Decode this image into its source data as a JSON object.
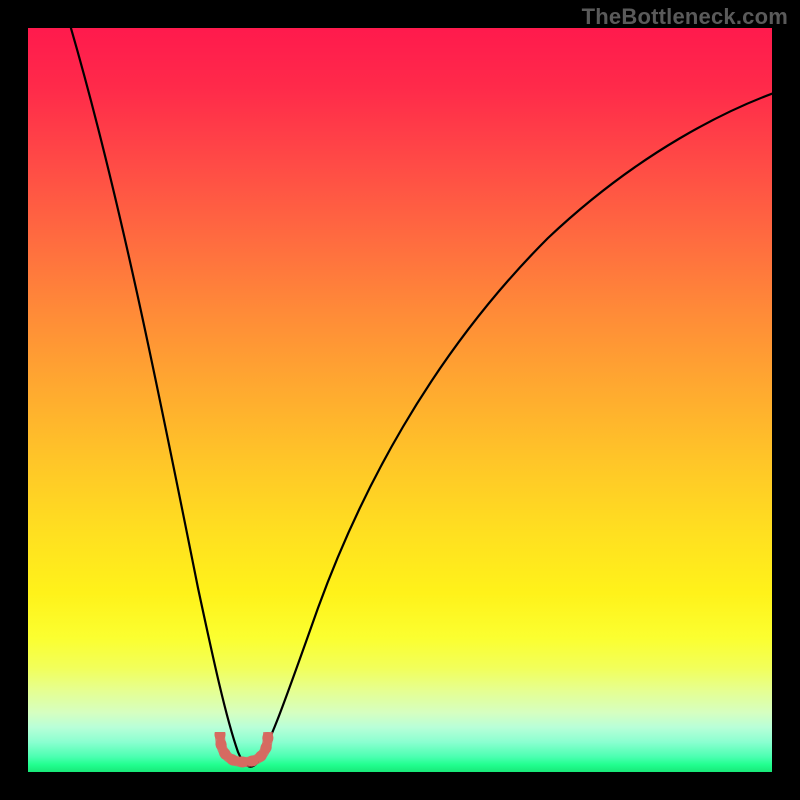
{
  "watermark": "TheBottleneck.com",
  "colors": {
    "curve_stroke": "#000000",
    "marker_stroke": "#d66a62",
    "background_frame": "#000000"
  },
  "chart_data": {
    "type": "line",
    "title": "",
    "xlabel": "",
    "ylabel": "",
    "xlim": [
      0,
      100
    ],
    "ylim": [
      0,
      100
    ],
    "grid": false,
    "legend": false,
    "series": [
      {
        "name": "bottleneck-curve",
        "x": [
          1,
          4,
          7,
          10,
          13,
          16,
          19,
          22,
          25,
          27,
          29,
          30.5,
          34,
          38,
          44,
          52,
          62,
          74,
          86,
          100
        ],
        "y": [
          100,
          82,
          66,
          52,
          40,
          29,
          20,
          12,
          6,
          3,
          1.5,
          2,
          6,
          13,
          24,
          38,
          53,
          67,
          78,
          86
        ]
      }
    ],
    "annotations": [
      {
        "name": "optimal-marker",
        "shape": "u",
        "x_center": 29,
        "y_bottom": 0,
        "color": "#d66a62"
      }
    ],
    "gradient_stops": [
      {
        "pct": 0,
        "color": "#ff1a4d"
      },
      {
        "pct": 50,
        "color": "#ffc528"
      },
      {
        "pct": 80,
        "color": "#fff21a"
      },
      {
        "pct": 100,
        "color": "#18e878"
      }
    ]
  }
}
